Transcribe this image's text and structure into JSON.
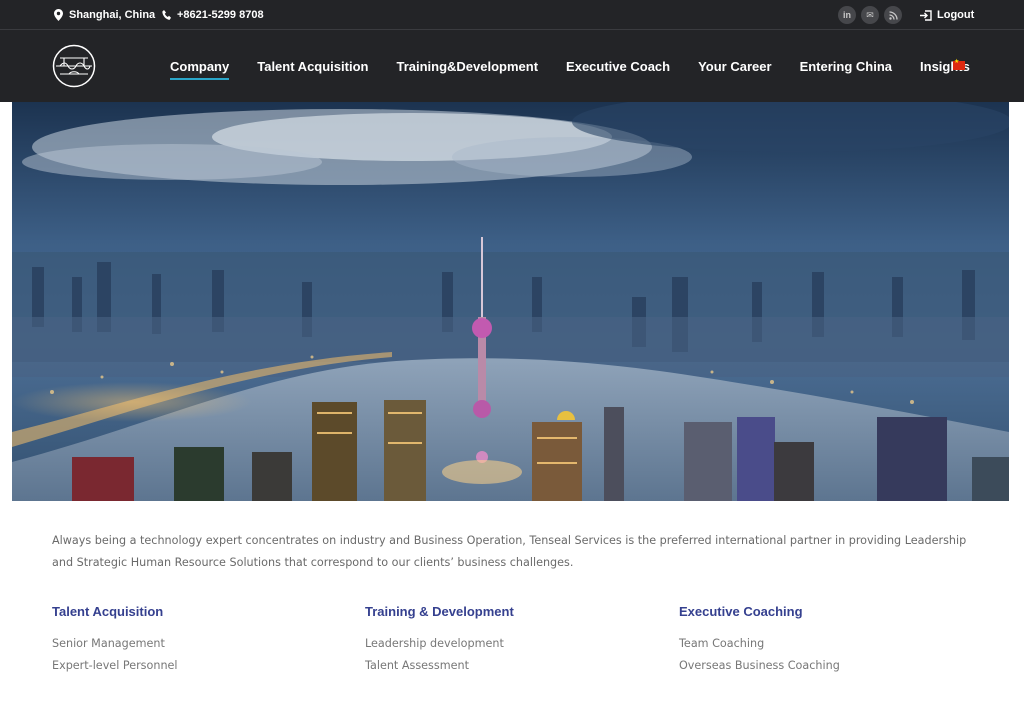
{
  "topbar": {
    "location": "Shanghai, China",
    "phone": "+8621-5299 8708",
    "social": [
      {
        "icon": "linkedin-icon",
        "glyph": "in"
      },
      {
        "icon": "mail-icon",
        "glyph": "✉"
      },
      {
        "icon": "rss-icon",
        "glyph": "◉"
      }
    ],
    "logout_label": "Logout"
  },
  "nav": {
    "items": [
      {
        "label": "Company",
        "active": true
      },
      {
        "label": "Talent Acquisition",
        "active": false
      },
      {
        "label": "Training&Development",
        "active": false
      },
      {
        "label": "Executive Coach",
        "active": false
      },
      {
        "label": "Your Career",
        "active": false
      },
      {
        "label": "Entering China",
        "active": false
      },
      {
        "label": "Insights",
        "active": false
      }
    ],
    "language_flag": "china-flag-icon"
  },
  "intro": "Always being a technology expert concentrates on industry and Business Operation, Tenseal Services is the preferred international partner in providing Leadership and Strategic Human Resource Solutions that correspond to our clients’ business challenges.",
  "services": [
    {
      "title": "Talent Acquisition",
      "items": [
        "Senior Management",
        "Expert-level Personnel"
      ]
    },
    {
      "title": "Training & Development",
      "items": [
        "Leadership development",
        "Talent Assessment"
      ]
    },
    {
      "title": "Executive Coaching",
      "items": [
        "Team Coaching",
        "Overseas Business Coaching"
      ]
    }
  ],
  "colors": {
    "header_bg": "#232427",
    "accent": "#2aa6c9",
    "heading": "#35408f"
  }
}
